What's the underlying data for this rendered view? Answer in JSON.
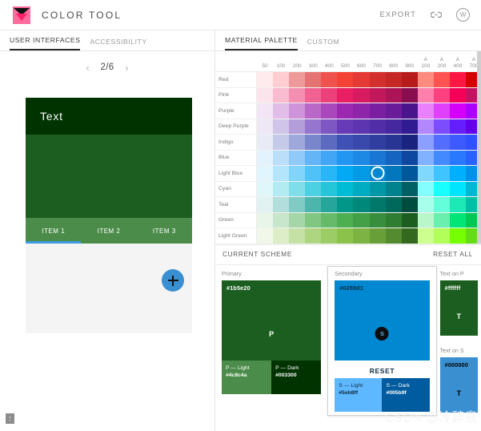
{
  "app": {
    "title": "COLOR  TOOL",
    "logo_icon": "color-tool-logo",
    "export_label": "EXPORT",
    "link_icon": "link-icon",
    "avatar_icon": "account-circle-icon"
  },
  "left_tabs": [
    {
      "label": "USER INTERFACES",
      "active": true
    },
    {
      "label": "ACCESSIBILITY",
      "active": false
    }
  ],
  "right_tabs": [
    {
      "label": "MATERIAL PALETTE",
      "active": true
    },
    {
      "label": "CUSTOM",
      "active": false
    }
  ],
  "pager": {
    "prev_icon": "chevron-left-icon",
    "next_icon": "chevron-right-icon",
    "count": "2/6"
  },
  "preview": {
    "header_text": "Text",
    "header_color": "#003300",
    "body_color": "#1b5e20",
    "tabbar_color": "#4c8c4a",
    "indicator_color": "#3a9be0",
    "canvas_color": "#f4f4f4",
    "tabs": [
      "ITEM 1",
      "ITEM 2",
      "ITEM 3"
    ],
    "fab_icon": "add-icon",
    "fab_color": "#3a8fd0"
  },
  "corner_badge_icon": "status-badge-icon",
  "palette": {
    "columns": [
      "50",
      "100",
      "200",
      "300",
      "400",
      "500",
      "600",
      "700",
      "800",
      "900"
    ],
    "accent_columns": [
      "100",
      "200",
      "400",
      "700"
    ],
    "accent_prefix": "A",
    "selected": {
      "row": "Light Blue",
      "column": "700",
      "hex": "#0288d1"
    },
    "rows": [
      {
        "name": "Red",
        "colors": [
          "#ffebee",
          "#ffcdd2",
          "#ef9a9a",
          "#e57373",
          "#ef5350",
          "#f44336",
          "#e53935",
          "#d32f2f",
          "#c62828",
          "#b71c1c",
          "#ff8a80",
          "#ff5252",
          "#ff1744",
          "#d50000"
        ]
      },
      {
        "name": "Pink",
        "colors": [
          "#fce4ec",
          "#f8bbd0",
          "#f48fb1",
          "#f06292",
          "#ec407a",
          "#e91e63",
          "#d81b60",
          "#c2185b",
          "#ad1457",
          "#880e4f",
          "#ff80ab",
          "#ff4081",
          "#f50057",
          "#c51162"
        ]
      },
      {
        "name": "Purple",
        "colors": [
          "#f3e5f5",
          "#e1bee7",
          "#ce93d8",
          "#ba68c8",
          "#ab47bc",
          "#9c27b0",
          "#8e24aa",
          "#7b1fa2",
          "#6a1b9a",
          "#4a148c",
          "#ea80fc",
          "#e040fb",
          "#d500f9",
          "#aa00ff"
        ]
      },
      {
        "name": "Deep Purple",
        "colors": [
          "#ede7f6",
          "#d1c4e9",
          "#b39ddb",
          "#9575cd",
          "#7e57c2",
          "#673ab7",
          "#5e35b1",
          "#512da8",
          "#4527a0",
          "#311b92",
          "#b388ff",
          "#7c4dff",
          "#651fff",
          "#6200ea"
        ]
      },
      {
        "name": "Indigo",
        "colors": [
          "#e8eaf6",
          "#c5cae9",
          "#9fa8da",
          "#7986cb",
          "#5c6bc0",
          "#3f51b5",
          "#3949ab",
          "#303f9f",
          "#283593",
          "#1a237e",
          "#8c9eff",
          "#536dfe",
          "#3d5afe",
          "#304ffe"
        ]
      },
      {
        "name": "Blue",
        "colors": [
          "#e3f2fd",
          "#bbdefb",
          "#90caf9",
          "#64b5f6",
          "#42a5f5",
          "#2196f3",
          "#1e88e5",
          "#1976d2",
          "#1565c0",
          "#0d47a1",
          "#82b1ff",
          "#448aff",
          "#2979ff",
          "#2962ff"
        ]
      },
      {
        "name": "Light Blue",
        "colors": [
          "#e1f5fe",
          "#b3e5fc",
          "#81d4fa",
          "#4fc3f7",
          "#29b6f6",
          "#03a9f4",
          "#039be5",
          "#0288d1",
          "#0277bd",
          "#01579b",
          "#80d8ff",
          "#40c4ff",
          "#00b0ff",
          "#0091ea"
        ]
      },
      {
        "name": "Cyan",
        "colors": [
          "#e0f7fa",
          "#b2ebf2",
          "#80deea",
          "#4dd0e1",
          "#26c6da",
          "#00bcd4",
          "#00acc1",
          "#0097a7",
          "#00838f",
          "#006064",
          "#84ffff",
          "#18ffff",
          "#00e5ff",
          "#00b8d4"
        ]
      },
      {
        "name": "Teal",
        "colors": [
          "#e0f2f1",
          "#b2dfdb",
          "#80cbc4",
          "#4db6ac",
          "#26a69a",
          "#009688",
          "#00897b",
          "#00796b",
          "#00695c",
          "#004d40",
          "#a7ffeb",
          "#64ffda",
          "#1de9b6",
          "#00bfa5"
        ]
      },
      {
        "name": "Green",
        "colors": [
          "#e8f5e9",
          "#c8e6c9",
          "#a5d6a7",
          "#81c784",
          "#66bb6a",
          "#4caf50",
          "#43a047",
          "#388e3c",
          "#2e7d32",
          "#1b5e20",
          "#b9f6ca",
          "#69f0ae",
          "#00e676",
          "#00c853"
        ]
      },
      {
        "name": "Light Green",
        "colors": [
          "#f1f8e9",
          "#dcedc8",
          "#c5e1a5",
          "#aed581",
          "#9ccc65",
          "#8bc34a",
          "#7cb342",
          "#689f38",
          "#558b2f",
          "#33691e",
          "#ccff90",
          "#b2ff59",
          "#76ff03",
          "#64dd17"
        ]
      }
    ]
  },
  "scheme": {
    "title": "CURRENT SCHEME",
    "reset_all": "RESET ALL",
    "primary": {
      "label": "Primary",
      "hex": "#1b5e20",
      "letter": "P",
      "text_color": "#ffffff",
      "light": {
        "label": "P — Light",
        "hex": "#4c8c4a",
        "text_color": "#ffffff"
      },
      "dark": {
        "label": "P — Dark",
        "hex": "#003300",
        "text_color": "#ffffff"
      }
    },
    "secondary": {
      "label": "Secondary",
      "hex": "#0288d1",
      "letter": "S",
      "text_color": "#0d2b40",
      "reset_label": "RESET",
      "light": {
        "label": "S — Light",
        "hex": "#5eb8ff",
        "text_color": "#0d2b40"
      },
      "dark": {
        "label": "S — Dark",
        "hex": "#005b9f",
        "text_color": "#ffffff"
      }
    },
    "text_on_primary": {
      "label": "Text on P",
      "hex": "#ffffff",
      "bg": "#1b5e20",
      "letter": "T",
      "text_color": "#ffffff"
    },
    "text_on_secondary": {
      "label": "Text on S",
      "hex": "#000000",
      "bg": "#3a8fd0",
      "letter": "T",
      "text_color": "#000000"
    }
  },
  "watermark": "CSDN @冷醉泉"
}
